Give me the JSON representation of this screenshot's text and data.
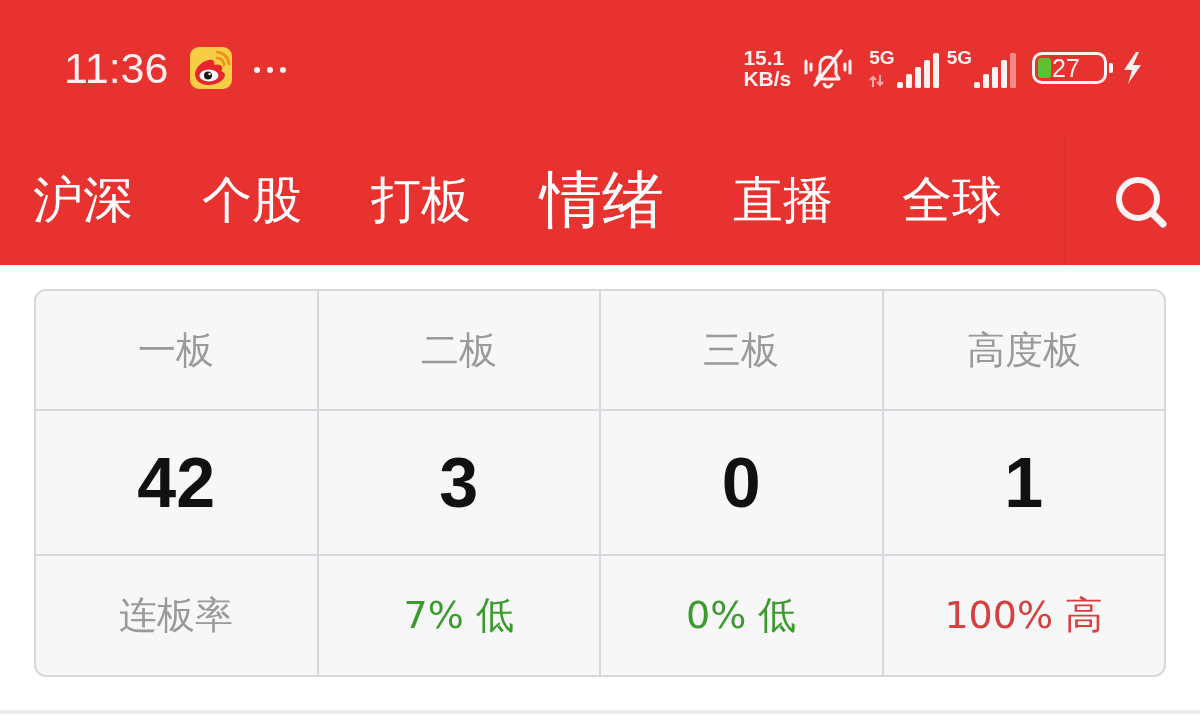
{
  "status_bar": {
    "time": "11:36",
    "net_speed": {
      "value": "15.1",
      "unit": "KB/s"
    },
    "ringer_muted": true,
    "signals": [
      {
        "label": "5G",
        "data_active": true
      },
      {
        "label": "5G",
        "data_active": false
      }
    ],
    "battery": {
      "text": "27",
      "charging": true
    }
  },
  "nav": {
    "tabs": [
      {
        "label": "沪深",
        "selected": false
      },
      {
        "label": "个股",
        "selected": false
      },
      {
        "label": "打板",
        "selected": false
      },
      {
        "label": "情绪",
        "selected": true
      },
      {
        "label": "直播",
        "selected": false
      },
      {
        "label": "全球",
        "selected": false
      }
    ]
  },
  "table": {
    "header": [
      "一板",
      "二板",
      "三板",
      "高度板"
    ],
    "counts": [
      "42",
      "3",
      "0",
      "1"
    ],
    "rates": [
      {
        "text": "连板率",
        "color": "#9a9a9a"
      },
      {
        "text": "7% 低",
        "color": "#3c9b2e"
      },
      {
        "text": "0% 低",
        "color": "#3c9b2e"
      },
      {
        "text": "100% 高",
        "color": "#d6403e"
      }
    ]
  }
}
